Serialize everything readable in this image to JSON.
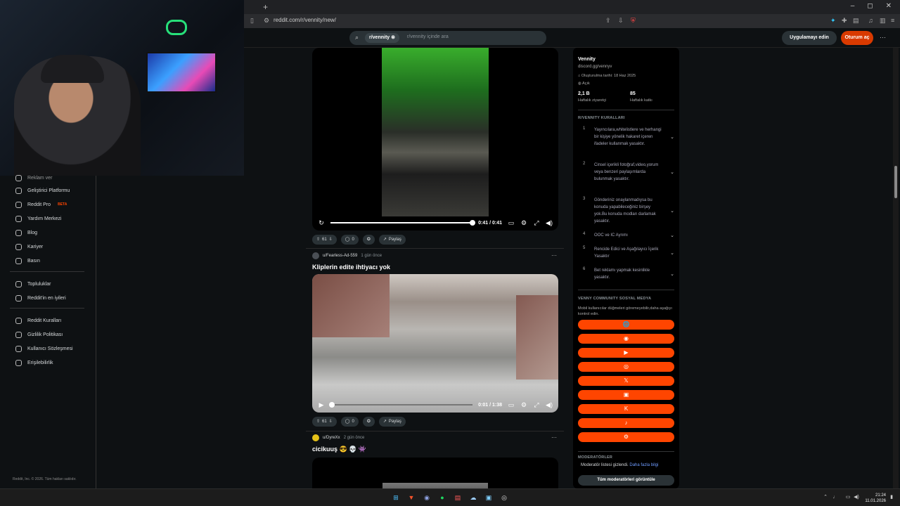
{
  "browser": {
    "new_tab": "+",
    "url": "reddit.com/r/vennity/new/",
    "win_min": "–",
    "win_max": "◻",
    "win_close": "✕"
  },
  "header": {
    "search_chip": "r/vennity",
    "search_placeholder": "r/vennity içinde ara",
    "app_button": "Uygulamayı edin",
    "login_button": "Oturum aç",
    "more": "···"
  },
  "sidebar": {
    "partial_item": "Reklam ver",
    "items_group1": [
      {
        "label": "Geliştirici Platformu",
        "icon": "code-icon"
      },
      {
        "label": "Reddit Pro",
        "icon": "pro-icon",
        "badge": "BETA"
      },
      {
        "label": "Yardım Merkezi",
        "icon": "help-icon"
      },
      {
        "label": "Blog",
        "icon": "book-icon"
      },
      {
        "label": "Kariyer",
        "icon": "briefcase-icon"
      },
      {
        "label": "Basın",
        "icon": "mic-icon"
      }
    ],
    "items_group2": [
      {
        "label": "Topluluklar",
        "icon": "communities-icon"
      },
      {
        "label": "Reddit'in en iyileri",
        "icon": "best-icon"
      }
    ],
    "items_group3": [
      {
        "label": "Reddit Kuralları",
        "icon": "rules-icon"
      },
      {
        "label": "Gizlilik Politikası",
        "icon": "privacy-icon"
      },
      {
        "label": "Kullanıcı Sözleşmesi",
        "icon": "agreement-icon"
      },
      {
        "label": "Erişilebilirlik",
        "icon": "accessibility-icon"
      }
    ],
    "copyright": "Reddit, Inc. © 2026. Tüm hakları saklıdır."
  },
  "posts": [
    {
      "video_time": "0:41 / 0:41",
      "progress": 1.0,
      "votes": "61",
      "comments": "0",
      "share": "Paylaş"
    },
    {
      "author": "u/Fearless-Ad-559",
      "time_ago": "1 gün önce",
      "title": "Kliplerin edite ihtiyacı yok",
      "video_time": "0:01 / 1:38",
      "progress": 0.01,
      "votes": "61",
      "comments": "0",
      "share": "Paylaş"
    },
    {
      "author": "u/DyreXx",
      "time_ago": "2 gün önce",
      "title": "cicikuuş 😎 💀 👾"
    }
  ],
  "community": {
    "name": "Vennity",
    "link": "discord.gg/vennyv",
    "created": "Oluşturulma tarihi: 18 Haz 2025",
    "status": "Açık",
    "visits_value": "2,1 B",
    "visits_label": "Haftalık ziyaretçi",
    "contrib_value": "85",
    "contrib_label": "Haftalık katkı"
  },
  "rules": {
    "heading": "R/VENNITY KURALLARI",
    "items": [
      {
        "n": "1",
        "text": "Yayıncılara,whitelistlere ve herhangi bir kişiye yönelik hakaret içeren ifadeler kullanmak yasaktır."
      },
      {
        "n": "2",
        "text": "Cinsel içerikli fotoğraf,video,yorum veya benzeri paylaşımlarda bulunmak yasaktır."
      },
      {
        "n": "3",
        "text": "Gönderiniz onaylanmadıysa bu konuda yapabileceğiniz birşey yok.Bu konuda modları darlamak yasaktır."
      },
      {
        "n": "4",
        "text": "OOC ve IC Ayrımı"
      },
      {
        "n": "5",
        "text": "Rencide Edici ve Aşağılayıcı İçerik Yasaktır"
      },
      {
        "n": "6",
        "text": "Bet reklamı yapmak kesinlikle yasaktır."
      }
    ]
  },
  "social": {
    "heading": "VENNY COMMUNITY SOSYAL MEDYA",
    "note": "Mobil kullanıcılar düğmeleri göremeyebilir,daha aşağıyı kontrol edin.",
    "buttons": [
      "🌐",
      "◉",
      "▶",
      "◎",
      "𝕏",
      "▣",
      "K",
      "♪",
      "⚙"
    ]
  },
  "moderators": {
    "heading": "MODERATÖRLER",
    "note": "Moderatör listesi gizlendi.",
    "more_link": "Daha fazla bilgi",
    "button": "Tüm moderatörleri görüntüle"
  },
  "taskbar": {
    "time": "21:24",
    "date": "11.01.2026"
  },
  "colors": {
    "accent": "#ff4500",
    "login": "#d93a00"
  }
}
